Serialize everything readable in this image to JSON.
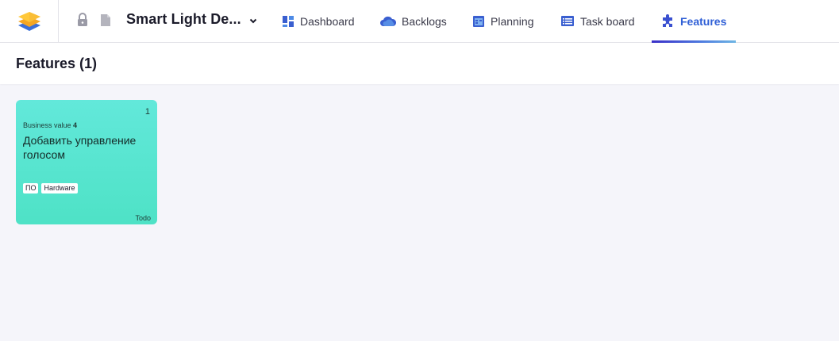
{
  "header": {
    "project_title": "Smart Light De...",
    "tabs": [
      {
        "label": "Dashboard",
        "icon": "dashboard-icon"
      },
      {
        "label": "Backlogs",
        "icon": "backlogs-icon"
      },
      {
        "label": "Planning",
        "icon": "planning-icon"
      },
      {
        "label": "Task board",
        "icon": "taskboard-icon"
      },
      {
        "label": "Features",
        "icon": "features-icon",
        "active": true
      }
    ]
  },
  "page": {
    "title": "Features (1)"
  },
  "features": [
    {
      "number": "1",
      "business_value_label": "Business value",
      "business_value": "4",
      "title": "Добавить управление голосом",
      "tags": [
        "ПО",
        "Hardware"
      ],
      "status": "Todo"
    }
  ],
  "colors": {
    "active_tab": "#2f5fd6",
    "card_gradient_top": "#62e8da",
    "card_gradient_bottom": "#4ee2c6",
    "page_background": "#f5f5fa"
  }
}
